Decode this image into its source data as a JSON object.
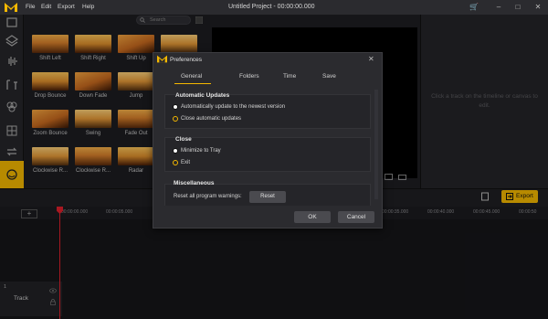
{
  "app": {
    "title": "Untitled Project - 00:00:00.000",
    "menu": [
      "File",
      "Edit",
      "Export",
      "Help"
    ],
    "accent": "#f5b800"
  },
  "media": {
    "search_placeholder": "Search",
    "transitions": [
      {
        "label": "Shift Left"
      },
      {
        "label": "Shift Right"
      },
      {
        "label": "Shift Up"
      },
      {
        "label": ""
      },
      {
        "label": "Drop Bounce"
      },
      {
        "label": "Down Fade"
      },
      {
        "label": "Jump"
      },
      {
        "label": ""
      },
      {
        "label": "Zoom Bounce"
      },
      {
        "label": "Swing"
      },
      {
        "label": "Fade Out"
      },
      {
        "label": ""
      },
      {
        "label": "Clockwise R..."
      },
      {
        "label": "Clockwise R..."
      },
      {
        "label": "Radar"
      },
      {
        "label": ""
      }
    ]
  },
  "properties": {
    "hint": "Click a track on the timeline or canvas to edit."
  },
  "timeline": {
    "export_label": "Export",
    "ticks": [
      "00:00:00.000",
      "00:00:05.000",
      "00:00:35.000",
      "00:00:40.000",
      "00:00:45.000",
      "00:00:50"
    ],
    "track_label": "Track",
    "track_number": "1"
  },
  "dialog": {
    "title": "Preferences",
    "tabs": [
      "General",
      "Folders",
      "Time",
      "Save"
    ],
    "active_tab": "General",
    "sections": {
      "auto_updates": {
        "title": "Automatic Updates",
        "options": [
          "Automatically update to the newest version",
          "Close automatic updates"
        ],
        "selected": "Close automatic updates"
      },
      "close": {
        "title": "Close",
        "options": [
          "Minimize to Tray",
          "Exit"
        ],
        "selected": "Exit"
      },
      "misc": {
        "title": "Miscellaneous",
        "reset_label": "Reset all program warnings:",
        "reset_button": "Reset"
      }
    },
    "ok": "OK",
    "cancel": "Cancel"
  }
}
